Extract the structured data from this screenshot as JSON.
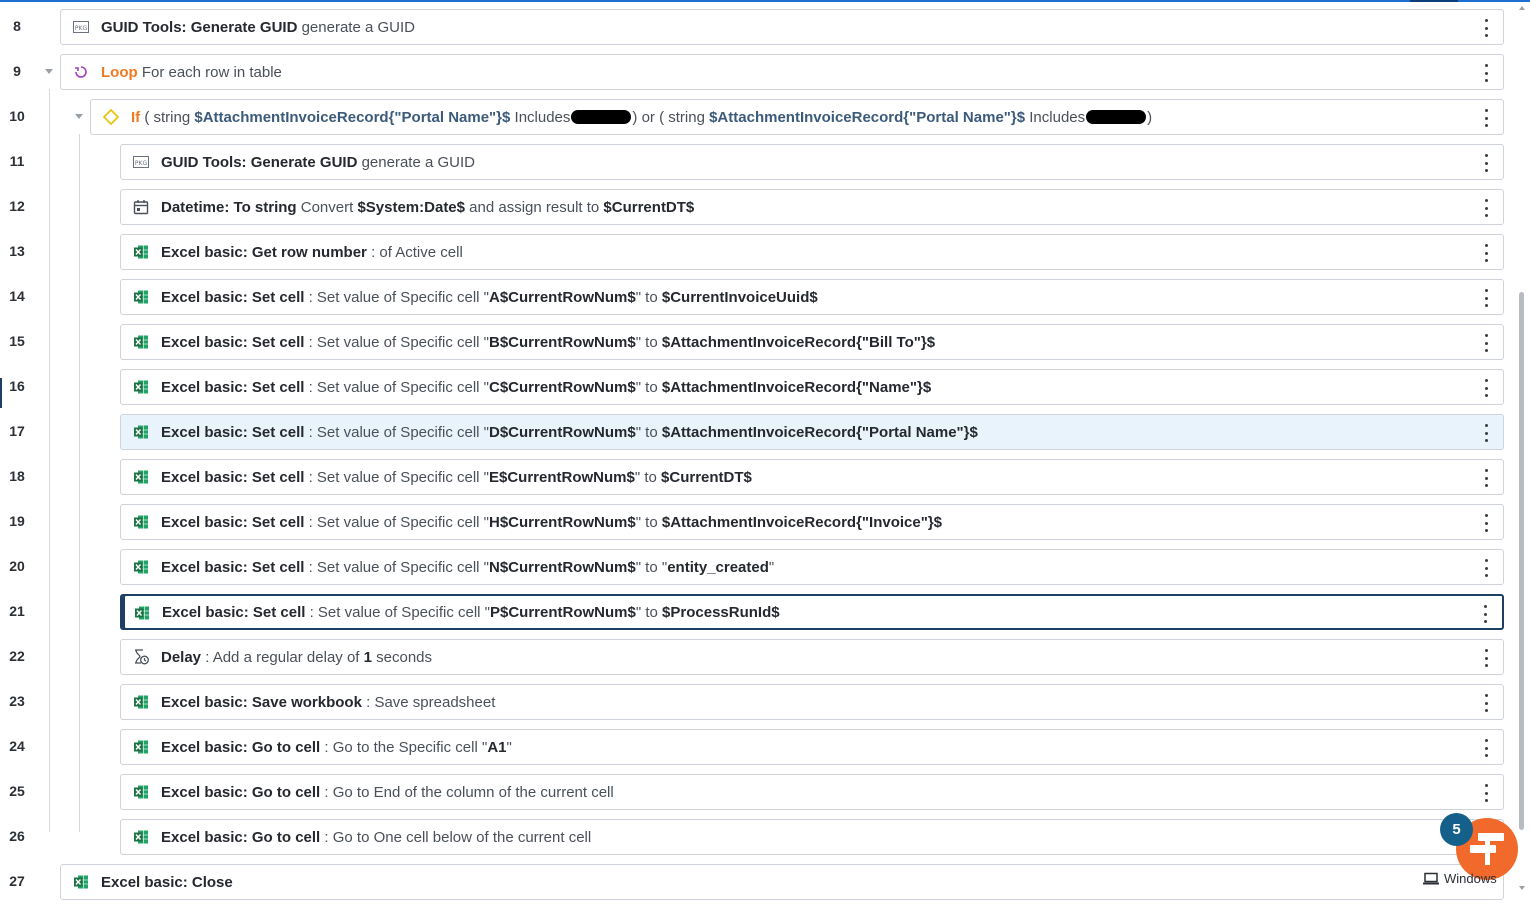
{
  "rows": [
    {
      "num": "8",
      "parts": [
        [
          "b",
          "GUID Tools: Generate GUID"
        ],
        [
          "t",
          " generate a GUID"
        ]
      ]
    },
    {
      "num": "9",
      "parts": [
        [
          "o",
          "Loop"
        ],
        [
          "t",
          " For each row in table"
        ]
      ]
    },
    {
      "num": "10",
      "parts": [
        [
          "o",
          "If"
        ],
        [
          "t",
          " ( string "
        ],
        [
          "v",
          "$AttachmentInvoiceRecord{\"Portal Name\"}$"
        ],
        [
          "t",
          " Includes"
        ],
        [
          "r",
          ""
        ],
        [
          "t",
          ") or ( string "
        ],
        [
          "v",
          "$AttachmentInvoiceRecord{\"Portal Name\"}$"
        ],
        [
          "t",
          " Includes"
        ],
        [
          "r",
          ""
        ],
        [
          "t",
          ")"
        ]
      ]
    },
    {
      "num": "11",
      "parts": [
        [
          "b",
          "GUID Tools: Generate GUID"
        ],
        [
          "t",
          " generate a GUID"
        ]
      ]
    },
    {
      "num": "12",
      "parts": [
        [
          "b",
          "Datetime: To string"
        ],
        [
          "t",
          " Convert "
        ],
        [
          "b",
          "$System:Date$"
        ],
        [
          "t",
          " and assign result to "
        ],
        [
          "b",
          "$CurrentDT$"
        ]
      ]
    },
    {
      "num": "13",
      "parts": [
        [
          "b",
          "Excel basic: Get row number"
        ],
        [
          "t",
          " : of Active cell"
        ]
      ]
    },
    {
      "num": "14",
      "parts": [
        [
          "b",
          "Excel basic: Set cell"
        ],
        [
          "t",
          " : Set value of Specific cell \""
        ],
        [
          "b",
          "A$CurrentRowNum$"
        ],
        [
          "t",
          "\" to "
        ],
        [
          "b",
          "$CurrentInvoiceUuid$"
        ]
      ]
    },
    {
      "num": "15",
      "parts": [
        [
          "b",
          "Excel basic: Set cell"
        ],
        [
          "t",
          " : Set value of Specific cell \""
        ],
        [
          "b",
          "B$CurrentRowNum$"
        ],
        [
          "t",
          "\" to "
        ],
        [
          "b",
          "$AttachmentInvoiceRecord{\"Bill To\"}$"
        ]
      ]
    },
    {
      "num": "16",
      "parts": [
        [
          "b",
          "Excel basic: Set cell"
        ],
        [
          "t",
          " : Set value of Specific cell \""
        ],
        [
          "b",
          "C$CurrentRowNum$"
        ],
        [
          "t",
          "\" to "
        ],
        [
          "b",
          "$AttachmentInvoiceRecord{\"Name\"}$"
        ]
      ]
    },
    {
      "num": "17",
      "parts": [
        [
          "b",
          "Excel basic: Set cell"
        ],
        [
          "t",
          " : Set value of Specific cell \""
        ],
        [
          "b",
          "D$CurrentRowNum$"
        ],
        [
          "t",
          "\" to "
        ],
        [
          "b",
          "$AttachmentInvoiceRecord{\"Portal Name\"}$"
        ]
      ]
    },
    {
      "num": "18",
      "parts": [
        [
          "b",
          "Excel basic: Set cell"
        ],
        [
          "t",
          " : Set value of Specific cell \""
        ],
        [
          "b",
          "E$CurrentRowNum$"
        ],
        [
          "t",
          "\" to "
        ],
        [
          "b",
          "$CurrentDT$"
        ]
      ]
    },
    {
      "num": "19",
      "parts": [
        [
          "b",
          "Excel basic: Set cell"
        ],
        [
          "t",
          " : Set value of Specific cell \""
        ],
        [
          "b",
          "H$CurrentRowNum$"
        ],
        [
          "t",
          "\" to "
        ],
        [
          "b",
          "$AttachmentInvoiceRecord{\"Invoice\"}$"
        ]
      ]
    },
    {
      "num": "20",
      "parts": [
        [
          "b",
          "Excel basic: Set cell"
        ],
        [
          "t",
          " : Set value of Specific cell \""
        ],
        [
          "b",
          "N$CurrentRowNum$"
        ],
        [
          "t",
          "\" to \""
        ],
        [
          "b",
          "entity_created"
        ],
        [
          "t",
          "\""
        ]
      ]
    },
    {
      "num": "21",
      "parts": [
        [
          "b",
          "Excel basic: Set cell"
        ],
        [
          "t",
          " : Set value of Specific cell \""
        ],
        [
          "b",
          "P$CurrentRowNum$"
        ],
        [
          "t",
          "\" to "
        ],
        [
          "b",
          "$ProcessRunId$"
        ]
      ]
    },
    {
      "num": "22",
      "parts": [
        [
          "b",
          "Delay"
        ],
        [
          "t",
          " : Add a regular delay of "
        ],
        [
          "b",
          "1"
        ],
        [
          "t",
          " seconds"
        ]
      ]
    },
    {
      "num": "23",
      "parts": [
        [
          "b",
          "Excel basic: Save workbook"
        ],
        [
          "t",
          " : Save spreadsheet"
        ]
      ]
    },
    {
      "num": "24",
      "parts": [
        [
          "b",
          "Excel basic: Go to cell"
        ],
        [
          "t",
          " : Go to the Specific cell \""
        ],
        [
          "b",
          "A1"
        ],
        [
          "t",
          "\""
        ]
      ]
    },
    {
      "num": "25",
      "parts": [
        [
          "b",
          "Excel basic: Go to cell"
        ],
        [
          "t",
          " : Go to End of the column of the current cell"
        ]
      ]
    },
    {
      "num": "26",
      "parts": [
        [
          "b",
          "Excel basic: Go to cell"
        ],
        [
          "t",
          " : Go to One cell below of the current cell"
        ]
      ]
    },
    {
      "num": "27",
      "parts": [
        [
          "b",
          "Excel basic: Close"
        ]
      ]
    }
  ],
  "icons": {
    "8": "package-icon",
    "9": "loop-icon",
    "10": "if-condition-icon",
    "11": "package-icon",
    "12": "calendar-icon",
    "13": "excel-icon",
    "14": "excel-icon",
    "15": "excel-icon",
    "16": "excel-icon",
    "17": "excel-icon",
    "18": "excel-icon",
    "19": "excel-icon",
    "20": "excel-icon",
    "21": "excel-icon",
    "22": "delay-icon",
    "23": "excel-icon",
    "24": "excel-icon",
    "25": "excel-icon",
    "26": "excel-icon",
    "27": "excel-icon"
  },
  "package_icon_text": "PKG",
  "highlighted_row": "17",
  "selected_row": "21",
  "notification_count": "5",
  "windows_label": "Windows",
  "colors": {
    "keyword_orange": "#f07a22",
    "variable_blue": "#3c5a7a",
    "highlight_bg": "#e8f3fc",
    "selected_border": "#1d3f66",
    "excel_green": "#1e7145",
    "fab_orange": "#f26a2b",
    "badge_blue": "#15608a"
  }
}
